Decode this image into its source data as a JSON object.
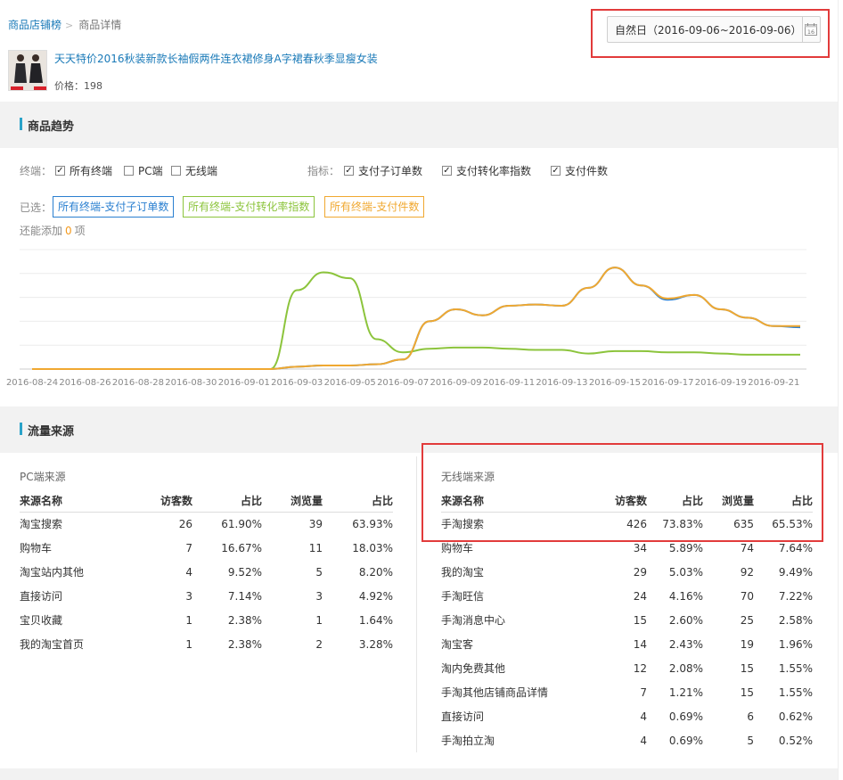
{
  "breadcrumb": {
    "root": "商品店铺榜",
    "current": "商品详情"
  },
  "date_filter": {
    "value": "自然日（2016-09-06~2016-09-06）",
    "icon": "calendar-icon",
    "day": "16"
  },
  "product": {
    "title": "天天特价2016秋装新款长袖假两件连衣裙修身A字裙春秋季显瘦女装",
    "price_label": "价格：198"
  },
  "trend_section": {
    "title": "商品趋势"
  },
  "terminal_filter": {
    "label": "终端：",
    "options": [
      {
        "label": "所有终端",
        "checked": true
      },
      {
        "label": "PC端",
        "checked": false
      },
      {
        "label": "无线端",
        "checked": false
      }
    ]
  },
  "metric_filter": {
    "label": "指标：",
    "options": [
      {
        "label": "支付子订单数",
        "checked": true
      },
      {
        "label": "支付转化率指数",
        "checked": true
      },
      {
        "label": "支付件数",
        "checked": true
      }
    ]
  },
  "selected": {
    "label": "已选：",
    "tags": [
      {
        "label": "所有终端-支付子订单数",
        "color": "#2a7fd0"
      },
      {
        "label": "所有终端-支付转化率指数",
        "color": "#8cc43c"
      },
      {
        "label": "所有终端-支付件数",
        "color": "#f0a830"
      }
    ]
  },
  "add_more": {
    "prefix": "还能添加",
    "count": "0",
    "suffix": "项"
  },
  "chart_data": {
    "type": "line",
    "x": [
      "2016-08-24",
      "2016-08-25",
      "2016-08-26",
      "2016-08-27",
      "2016-08-28",
      "2016-08-29",
      "2016-08-30",
      "2016-08-31",
      "2016-09-01",
      "2016-09-02",
      "2016-09-03",
      "2016-09-04",
      "2016-09-05",
      "2016-09-06",
      "2016-09-07",
      "2016-09-08",
      "2016-09-09",
      "2016-09-10",
      "2016-09-11",
      "2016-09-12",
      "2016-09-13",
      "2016-09-14",
      "2016-09-15",
      "2016-09-16",
      "2016-09-17",
      "2016-09-18",
      "2016-09-19",
      "2016-09-20",
      "2016-09-21",
      "2016-09-22"
    ],
    "tick_labels": [
      "2016-08-24",
      "2016-08-26",
      "2016-08-28",
      "2016-08-30",
      "2016-09-01",
      "2016-09-03",
      "2016-09-05",
      "2016-09-07",
      "2016-09-09",
      "2016-09-11",
      "2016-09-13",
      "2016-09-15",
      "2016-09-17",
      "2016-09-19",
      "2016-09-21"
    ],
    "ylim": [
      0,
      100
    ],
    "grid": true,
    "series": [
      {
        "color": "#2a7fd0",
        "values": [
          0,
          0,
          0,
          0,
          0,
          0,
          0,
          0,
          0,
          0,
          2,
          3,
          3,
          4,
          8,
          40,
          50,
          45,
          53,
          54,
          53,
          68,
          85,
          70,
          58,
          62,
          50,
          43,
          36,
          35
        ]
      },
      {
        "color": "#8cc43c",
        "values": [
          0,
          0,
          0,
          0,
          0,
          0,
          0,
          0,
          0,
          0,
          66,
          81,
          76,
          25,
          14,
          17,
          18,
          18,
          17,
          16,
          16,
          13,
          15,
          15,
          14,
          14,
          13,
          12,
          12,
          12
        ]
      },
      {
        "color": "#f0a830",
        "values": [
          0,
          0,
          0,
          0,
          0,
          0,
          0,
          0,
          0,
          0,
          2,
          3,
          3,
          4,
          8,
          40,
          50,
          45,
          53,
          54,
          53,
          68,
          85,
          70,
          59,
          62,
          50,
          43,
          36,
          36
        ]
      }
    ]
  },
  "traffic_section": {
    "title": "流量来源"
  },
  "pc_sources": {
    "title": "PC端来源",
    "headers": [
      "来源名称",
      "访客数",
      "占比",
      "浏览量",
      "占比"
    ],
    "rows": [
      [
        "淘宝搜索",
        "26",
        "61.90%",
        "39",
        "63.93%"
      ],
      [
        "购物车",
        "7",
        "16.67%",
        "11",
        "18.03%"
      ],
      [
        "淘宝站内其他",
        "4",
        "9.52%",
        "5",
        "8.20%"
      ],
      [
        "直接访问",
        "3",
        "7.14%",
        "3",
        "4.92%"
      ],
      [
        "宝贝收藏",
        "1",
        "2.38%",
        "1",
        "1.64%"
      ],
      [
        "我的淘宝首页",
        "1",
        "2.38%",
        "2",
        "3.28%"
      ]
    ]
  },
  "mobile_sources": {
    "title": "无线端来源",
    "headers": [
      "来源名称",
      "访客数",
      "占比",
      "浏览量",
      "占比"
    ],
    "rows": [
      [
        "手淘搜索",
        "426",
        "73.83%",
        "635",
        "65.53%"
      ],
      [
        "购物车",
        "34",
        "5.89%",
        "74",
        "7.64%"
      ],
      [
        "我的淘宝",
        "29",
        "5.03%",
        "92",
        "9.49%"
      ],
      [
        "手淘旺信",
        "24",
        "4.16%",
        "70",
        "7.22%"
      ],
      [
        "手淘消息中心",
        "15",
        "2.60%",
        "25",
        "2.58%"
      ],
      [
        "淘宝客",
        "14",
        "2.43%",
        "19",
        "1.96%"
      ],
      [
        "淘内免费其他",
        "12",
        "2.08%",
        "15",
        "1.55%"
      ],
      [
        "手淘其他店铺商品详情",
        "7",
        "1.21%",
        "15",
        "1.55%"
      ],
      [
        "直接访问",
        "4",
        "0.69%",
        "6",
        "0.62%"
      ],
      [
        "手淘拍立淘",
        "4",
        "0.69%",
        "5",
        "0.52%"
      ]
    ]
  }
}
